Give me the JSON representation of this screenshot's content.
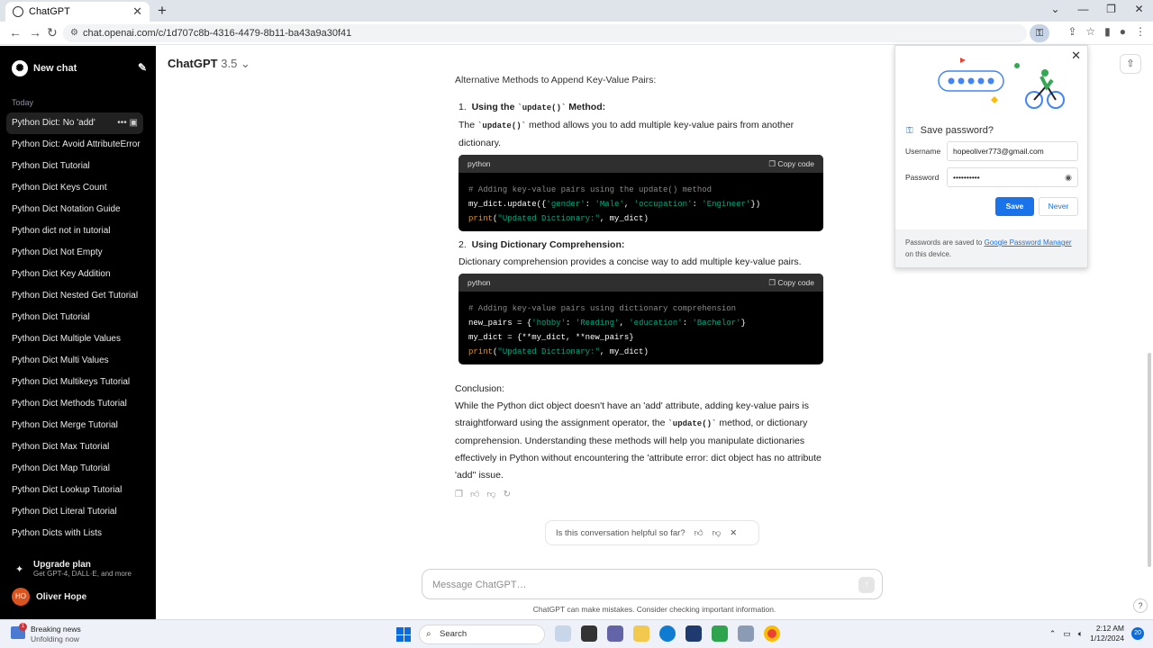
{
  "browser": {
    "tab_title": "ChatGPT",
    "url": "chat.openai.com/c/1d707c8b-4316-4479-8b11-ba43a9a30f41"
  },
  "sidebar": {
    "new_chat": "New chat",
    "section_today": "Today",
    "history": [
      {
        "label": "Python Dict: No 'add'",
        "active": true
      },
      {
        "label": "Python Dict: Avoid AttributeError"
      },
      {
        "label": "Python Dict Tutorial"
      },
      {
        "label": "Python Dict Keys Count"
      },
      {
        "label": "Python Dict Notation Guide"
      },
      {
        "label": "Python dict not in tutorial"
      },
      {
        "label": "Python Dict Not Empty"
      },
      {
        "label": "Python Dict Key Addition"
      },
      {
        "label": "Python Dict Nested Get Tutorial"
      },
      {
        "label": "Python Dict Tutorial"
      },
      {
        "label": "Python Dict Multiple Values"
      },
      {
        "label": "Python Dict Multi Values"
      },
      {
        "label": "Python Dict Multikeys Tutorial"
      },
      {
        "label": "Python Dict Methods Tutorial"
      },
      {
        "label": "Python Dict Merge Tutorial"
      },
      {
        "label": "Python Dict Max Tutorial"
      },
      {
        "label": "Python Dict Map Tutorial"
      },
      {
        "label": "Python Dict Lookup Tutorial"
      },
      {
        "label": "Python Dict Literal Tutorial"
      },
      {
        "label": "Python Dicts with Lists"
      }
    ],
    "upgrade_title": "Upgrade plan",
    "upgrade_sub": "Get GPT-4, DALL·E, and more",
    "user_initials": "HO",
    "user_name": "Oliver Hope"
  },
  "header": {
    "model": "ChatGPT",
    "version": "3.5"
  },
  "message": {
    "clipped_heading": "Alternative Methods to Append Key-Value Pairs:",
    "item1_title": "Using the",
    "item1_code": "`update()`",
    "item1_title_end": "Method:",
    "item1_text_a": "The",
    "item1_text_code": "`update()`",
    "item1_text_b": "method allows you to add multiple key-value pairs from another dictionary.",
    "item2_title": "Using Dictionary Comprehension:",
    "item2_text": "Dictionary comprehension provides a concise way to add multiple key-value pairs.",
    "code_lang": "python",
    "copy_label": "Copy code",
    "code1": {
      "comment": "# Adding key-value pairs using the update() method",
      "l2_a": "my_dict.update({",
      "s1": "'gender'",
      "s2": "'Male'",
      "s3": "'occupation'",
      "s4": "'Engineer'",
      "fn": "print",
      "s5": "\"Updated Dictionary:\"",
      "tail": ", my_dict)"
    },
    "code2": {
      "comment": "# Adding key-value pairs using dictionary comprehension",
      "l2_a": "new_pairs = {",
      "s1": "'hobby'",
      "s2": "'Reading'",
      "s3": "'education'",
      "s4": "'Bachelor'",
      "l3": "my_dict = {**my_dict, **new_pairs}",
      "fn": "print",
      "s5": "\"Updated Dictionary:\"",
      "tail": ", my_dict)"
    },
    "conclusion_head": "Conclusion:",
    "conclusion_a": "While the Python dict object doesn't have an 'add' attribute, adding key-value pairs is straightforward using the assignment operator, the",
    "conclusion_code": "`update()`",
    "conclusion_b": "method, or dictionary comprehension. Understanding these methods will help you manipulate dictionaries effectively in Python without encountering the 'attribute error: dict object has no attribute 'add'' issue."
  },
  "helpful_prompt": "Is this conversation helpful so far?",
  "composer": {
    "placeholder": "Message ChatGPT…"
  },
  "disclaimer": "ChatGPT can make mistakes. Consider checking important information.",
  "password_popup": {
    "title": "Save password?",
    "username_label": "Username",
    "username_value": "hopeoliver773@gmail.com",
    "password_label": "Password",
    "password_value": "••••••••••",
    "save": "Save",
    "never": "Never",
    "footer_a": "Passwords are saved to",
    "footer_link": "Google Password Manager",
    "footer_b": "on this device."
  },
  "taskbar": {
    "news_title": "Breaking news",
    "news_sub": "Unfolding now",
    "news_badge": "1",
    "search": "Search",
    "time": "2:12 AM",
    "date": "1/12/2024",
    "notif_count": "20"
  },
  "colors": {
    "accent": "#1a73e8",
    "sidebar_bg": "#000000",
    "code_string": "#00a67d",
    "code_fn": "#e9950c"
  }
}
